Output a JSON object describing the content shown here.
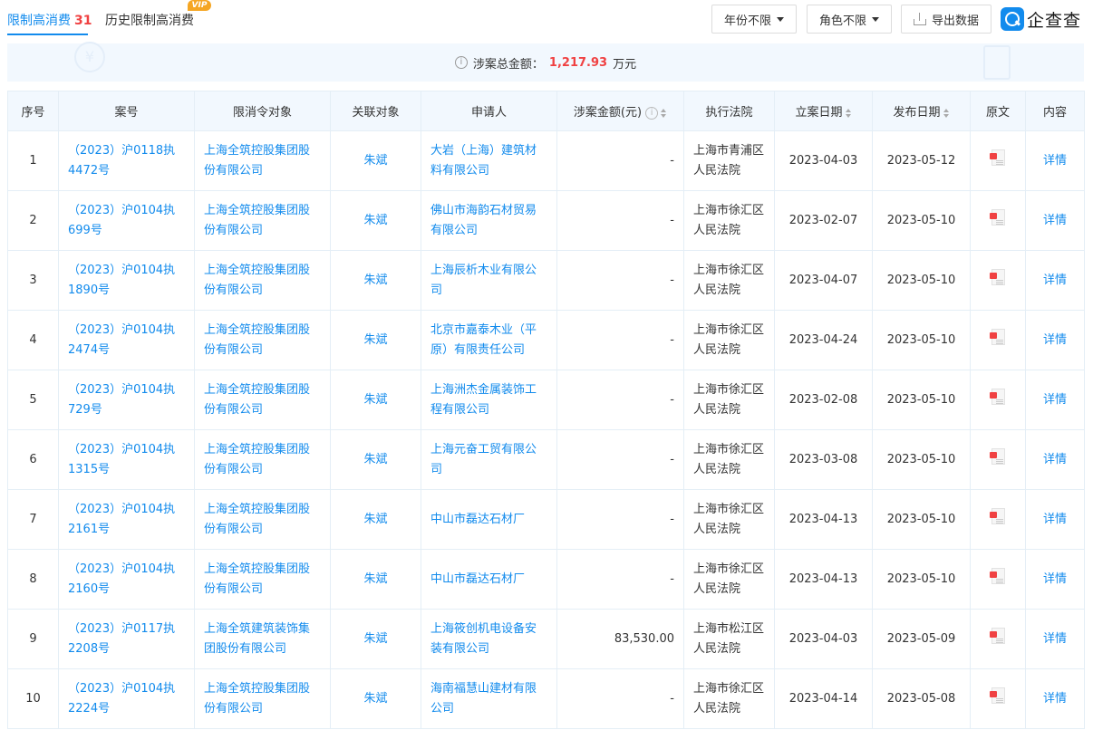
{
  "tabs": {
    "active_label": "限制高消费",
    "active_count": "31",
    "history_label": "历史限制高消费",
    "vip_badge": "VIP"
  },
  "toolbar": {
    "year_filter": "年份不限",
    "role_filter": "角色不限",
    "export_label": "导出数据",
    "logo_text": "企查查"
  },
  "summary": {
    "label": "涉案总金额：",
    "amount": "1,217.93",
    "unit": "万元"
  },
  "table": {
    "headers": {
      "index": "序号",
      "case_no": "案号",
      "target": "限消令对象",
      "related": "关联对象",
      "applicant": "申请人",
      "amount": "涉案金额(元)",
      "court": "执行法院",
      "filed_date": "立案日期",
      "publish_date": "发布日期",
      "original": "原文",
      "content": "内容"
    },
    "rows": [
      {
        "index": "1",
        "case_no": "（2023）沪0118执4472号",
        "target": "上海全筑控股集团股份有限公司",
        "related": "朱斌",
        "applicant": "大岩（上海）建筑材料有限公司",
        "amount": "-",
        "court": "上海市青浦区人民法院",
        "filed": "2023-04-03",
        "published": "2023-05-12",
        "detail": "详情"
      },
      {
        "index": "2",
        "case_no": "（2023）沪0104执699号",
        "target": "上海全筑控股集团股份有限公司",
        "related": "朱斌",
        "applicant": "佛山市海韵石材贸易有限公司",
        "amount": "-",
        "court": "上海市徐汇区人民法院",
        "filed": "2023-02-07",
        "published": "2023-05-10",
        "detail": "详情"
      },
      {
        "index": "3",
        "case_no": "（2023）沪0104执1890号",
        "target": "上海全筑控股集团股份有限公司",
        "related": "朱斌",
        "applicant": "上海辰析木业有限公司",
        "amount": "-",
        "court": "上海市徐汇区人民法院",
        "filed": "2023-04-07",
        "published": "2023-05-10",
        "detail": "详情"
      },
      {
        "index": "4",
        "case_no": "（2023）沪0104执2474号",
        "target": "上海全筑控股集团股份有限公司",
        "related": "朱斌",
        "applicant": "北京市嘉泰木业（平原）有限责任公司",
        "amount": "-",
        "court": "上海市徐汇区人民法院",
        "filed": "2023-04-24",
        "published": "2023-05-10",
        "detail": "详情"
      },
      {
        "index": "5",
        "case_no": "（2023）沪0104执729号",
        "target": "上海全筑控股集团股份有限公司",
        "related": "朱斌",
        "applicant": "上海洲杰金属装饰工程有限公司",
        "amount": "-",
        "court": "上海市徐汇区人民法院",
        "filed": "2023-02-08",
        "published": "2023-05-10",
        "detail": "详情"
      },
      {
        "index": "6",
        "case_no": "（2023）沪0104执1315号",
        "target": "上海全筑控股集团股份有限公司",
        "related": "朱斌",
        "applicant": "上海元奋工贸有限公司",
        "amount": "-",
        "court": "上海市徐汇区人民法院",
        "filed": "2023-03-08",
        "published": "2023-05-10",
        "detail": "详情"
      },
      {
        "index": "7",
        "case_no": "（2023）沪0104执2161号",
        "target": "上海全筑控股集团股份有限公司",
        "related": "朱斌",
        "applicant": "中山市磊达石材厂",
        "amount": "-",
        "court": "上海市徐汇区人民法院",
        "filed": "2023-04-13",
        "published": "2023-05-10",
        "detail": "详情"
      },
      {
        "index": "8",
        "case_no": "（2023）沪0104执2160号",
        "target": "上海全筑控股集团股份有限公司",
        "related": "朱斌",
        "applicant": "中山市磊达石材厂",
        "amount": "-",
        "court": "上海市徐汇区人民法院",
        "filed": "2023-04-13",
        "published": "2023-05-10",
        "detail": "详情"
      },
      {
        "index": "9",
        "case_no": "（2023）沪0117执2208号",
        "target": "上海全筑建筑装饰集团股份有限公司",
        "related": "朱斌",
        "applicant": "上海筱创机电设备安装有限公司",
        "amount": "83,530.00",
        "court": "上海市松江区人民法院",
        "filed": "2023-04-03",
        "published": "2023-05-09",
        "detail": "详情"
      },
      {
        "index": "10",
        "case_no": "（2023）沪0104执2224号",
        "target": "上海全筑控股集团股份有限公司",
        "related": "朱斌",
        "applicant": "海南福慧山建材有限公司",
        "amount": "-",
        "court": "上海市徐汇区人民法院",
        "filed": "2023-04-14",
        "published": "2023-05-08",
        "detail": "详情"
      }
    ]
  }
}
